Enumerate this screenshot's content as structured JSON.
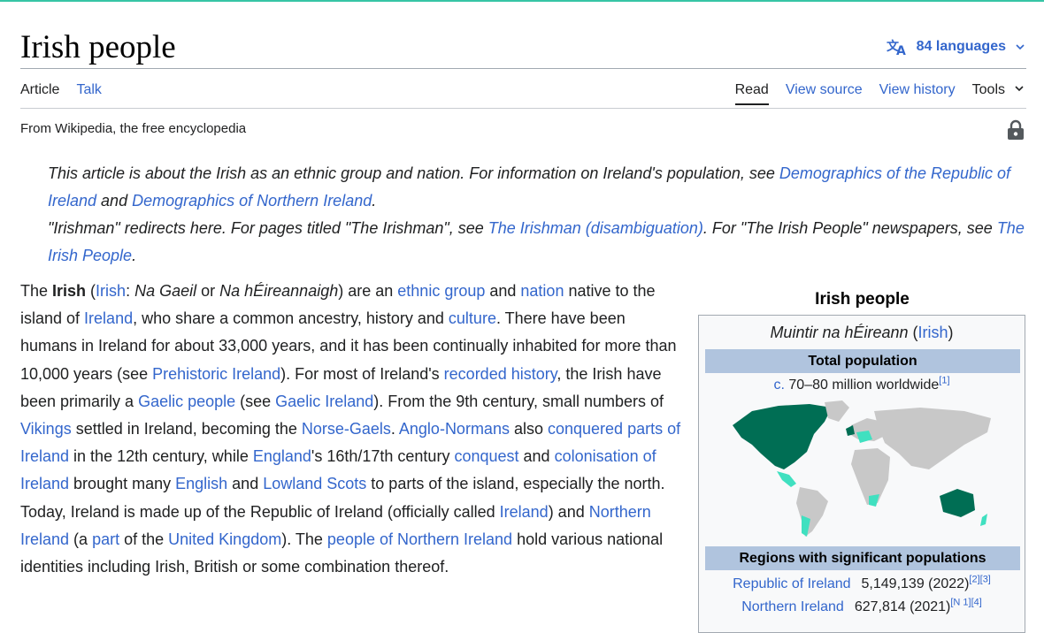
{
  "article": {
    "title": "Irish people",
    "languages": "84 languages",
    "tabs_left": [
      "Article",
      "Talk"
    ],
    "tabs_right": {
      "read": "Read",
      "view_source": "View source",
      "view_history": "View history",
      "tools": "Tools"
    },
    "tagline": "From Wikipedia, the free encyclopedia"
  },
  "hatnote": {
    "l1a": "This article is about the Irish as an ethnic group and nation. For information on Ireland's population, see ",
    "l1link1": "Demographics of the Republic of Ireland",
    "l1b": " and ",
    "l1link2": "Demographics of Northern Ireland",
    "l1c": ".",
    "l2a": "\"Irishman\" redirects here. For pages titled \"The Irishman\", see ",
    "l2link1": "The Irishman (disambiguation)",
    "l2b": ". For \"The Irish People\" newspapers, see ",
    "l2link2": "The Irish People",
    "l2c": "."
  },
  "lead": {
    "t0": "The ",
    "b0": "Irish",
    "t1": " (",
    "l_irish": "Irish",
    "t2": ": ",
    "i1": "Na Gaeil",
    "t3": " or ",
    "i2": "Na hÉireannaigh",
    "t4": ") are an ",
    "l_ethnic": "ethnic group",
    "t5": " and ",
    "l_nation": "nation",
    "t6": " native to the island of ",
    "l_ireland": "Ireland",
    "t7": ", who share a common ancestry, history and ",
    "l_culture": "culture",
    "t8": ". There have been humans in Ireland for about 33,000 years, and it has been continually inhabited for more than 10,000 years (see ",
    "l_prehist": "Prehistoric Ireland",
    "t9": "). For most of Ireland's ",
    "l_recorded": "recorded history",
    "t10": ", the Irish have been primarily a ",
    "l_gaelic": "Gaelic people",
    "t11": " (see ",
    "l_gaelicire": "Gaelic Ireland",
    "t12": "). From the 9th century, small numbers of ",
    "l_vikings": "Vikings",
    "t13": " settled in Ireland, becoming the ",
    "l_norse": "Norse-Gaels",
    "t14": ". ",
    "l_anglo": "Anglo-Normans",
    "t15": " also ",
    "l_conquered": "conquered parts of Ireland",
    "t16": " in the 12th century, while ",
    "l_england": "England",
    "t17": "'s 16th/17th century ",
    "l_conquest": "conquest",
    "t18": " and ",
    "l_colon": "colonisation of Ireland",
    "t19": " brought many ",
    "l_english": "English",
    "t20": " and ",
    "l_lowland": "Lowland Scots",
    "t21": " to parts of the island, especially the north. Today, Ireland is made up of the Republic of Ireland (officially called ",
    "l_ireland2": "Ireland",
    "t22": ") and ",
    "l_ni": "Northern Ireland",
    "t23": " (a ",
    "l_part": "part",
    "t24": " of the ",
    "l_uk": "United Kingdom",
    "t25": "). The ",
    "l_peopleni": "people of Northern Ireland",
    "t26": " hold various national identities including Irish, British or some combination thereof."
  },
  "infobox": {
    "title": "Irish people",
    "native_name": "Muintir na hÉireann",
    "native_lang_open": " (",
    "native_lang": "Irish",
    "native_lang_close": ")",
    "total_header": "Total population",
    "pop_circa": "c.",
    "pop_value": " 70–80 million worldwide",
    "pop_ref": "[1]",
    "regions_header": "Regions with significant populations",
    "regions": [
      {
        "name": "Republic of Ireland",
        "value": "5,149,139 (2022)",
        "refs": "[2][3]"
      },
      {
        "name": "Northern Ireland",
        "value": "627,814 (2021)",
        "refs": "[N 1][4]"
      }
    ]
  },
  "colors": {
    "link": "#3366cc",
    "header_bg": "#b0c4de",
    "map_dark": "#006e54",
    "map_light": "#40e0c0",
    "map_grey": "#c8c8c8"
  }
}
